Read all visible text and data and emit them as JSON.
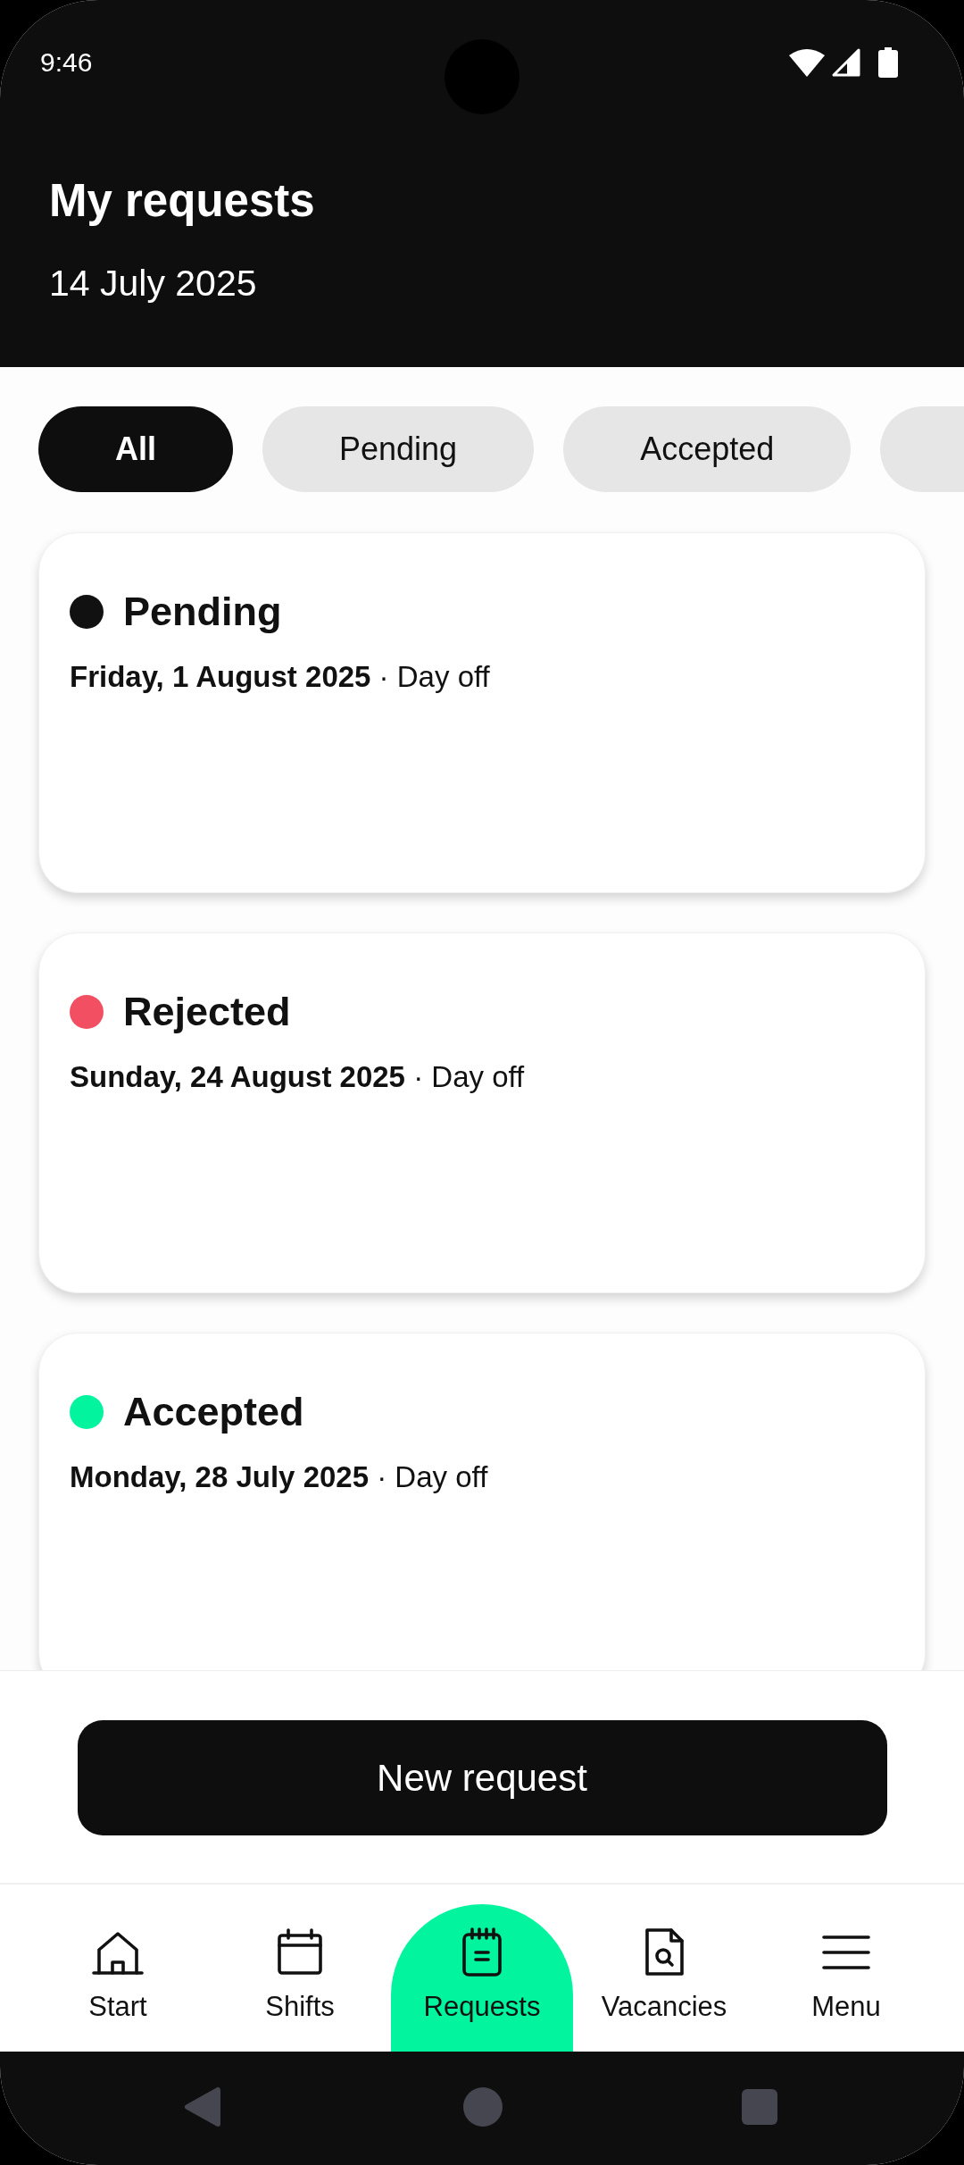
{
  "status_bar": {
    "time": "9:46"
  },
  "header": {
    "title": "My requests",
    "date": "14 July 2025"
  },
  "filters": [
    {
      "label": "All",
      "selected": true
    },
    {
      "label": "Pending",
      "selected": false
    },
    {
      "label": "Accepted",
      "selected": false
    },
    {
      "selected": false
    }
  ],
  "requests": [
    {
      "status": "Pending",
      "color": "#111111",
      "details": "**Friday, 1 August 2025** · Day off"
    },
    {
      "status": "Rejected",
      "color": "#f24f63",
      "details": "**Sunday, 24 August 2025** · Day off"
    },
    {
      "status": "Accepted",
      "color": "#02f59e",
      "details": "**Monday, 28 July 2025** · Day off"
    }
  ],
  "new_request_button": {
    "label": "New request"
  },
  "nav": [
    {
      "label": "Start",
      "selected": false
    },
    {
      "label": "Shifts",
      "selected": false
    },
    {
      "label": "Requests",
      "selected": true
    },
    {
      "label": "Vacancies",
      "selected": false
    },
    {
      "label": "Menu",
      "selected": false
    }
  ]
}
